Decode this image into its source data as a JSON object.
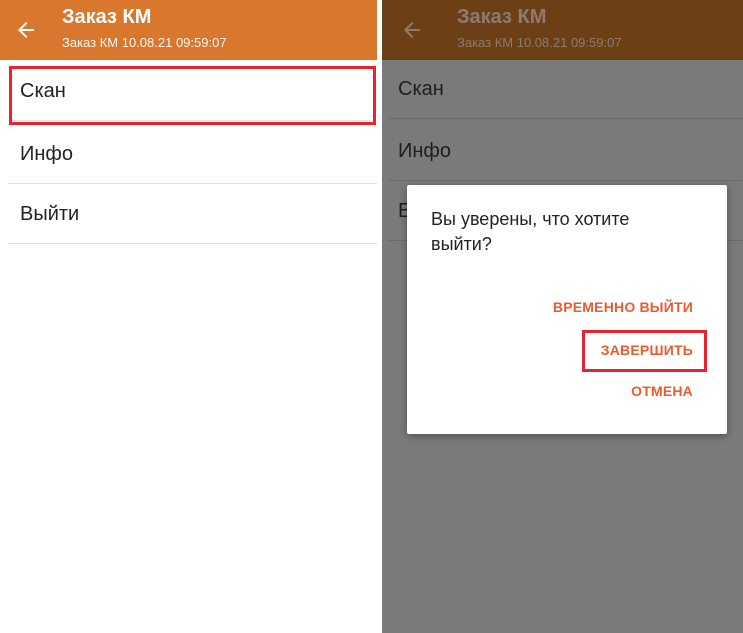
{
  "left_screen": {
    "appbar": {
      "title": "Заказ КМ",
      "subtitle": "Заказ КМ 10.08.21 09:59:07",
      "back_icon": "arrow-left-icon",
      "color": "#d9772f"
    },
    "menu": [
      {
        "label": "Скан"
      },
      {
        "label": "Инфо"
      },
      {
        "label": "Выйти"
      }
    ],
    "highlight_color": "#e8232f"
  },
  "right_screen": {
    "appbar": {
      "title": "Заказ КМ",
      "subtitle": "Заказ КМ 10.08.21 09:59:07",
      "back_icon": "arrow-left-icon"
    },
    "menu": [
      {
        "label": "Скан"
      },
      {
        "label": "Инфо"
      },
      {
        "label": "В"
      }
    ],
    "dialog": {
      "message": "Вы уверены, что хотите выйти?",
      "buttons": {
        "temp_exit": "ВРЕМЕННО ВЫЙТИ",
        "finish": "ЗАВЕРШИТЬ",
        "cancel": "ОТМЕНА"
      },
      "button_color": "#ec5a2e"
    }
  }
}
